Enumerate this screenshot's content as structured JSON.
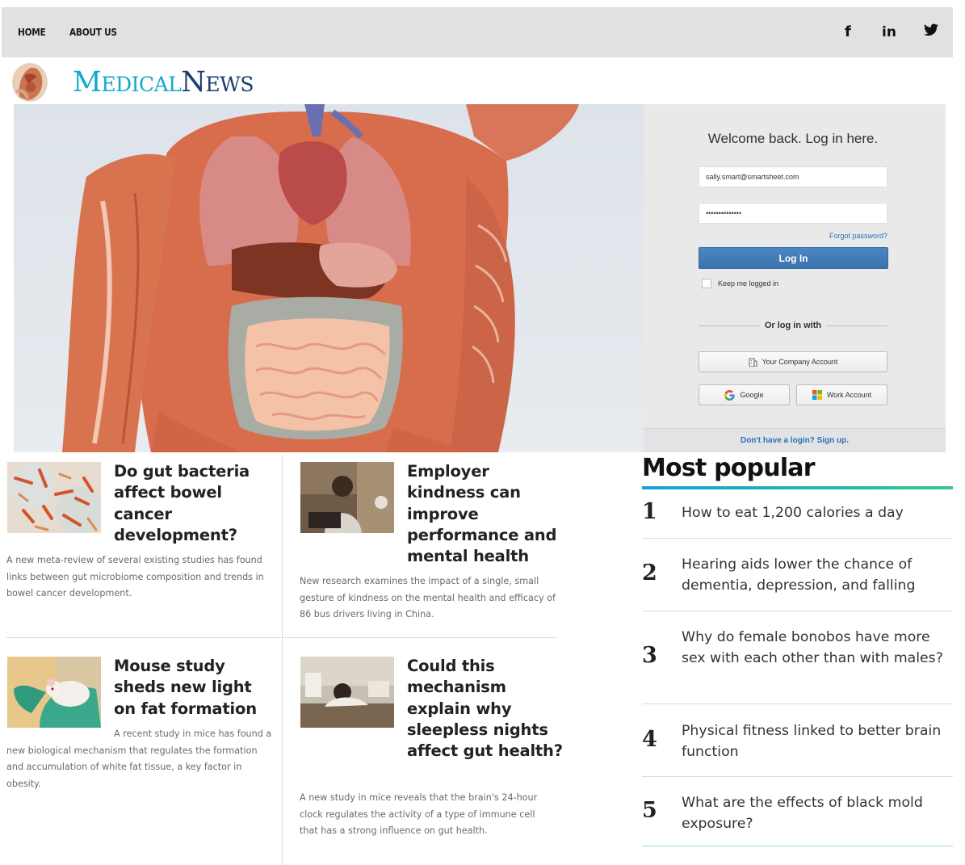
{
  "nav": {
    "links": [
      "HOME",
      "ABOUT US"
    ],
    "social": [
      {
        "icon": "facebook-icon",
        "glyph": "f"
      },
      {
        "icon": "linkedin-icon",
        "glyph": "in"
      },
      {
        "icon": "twitter-icon",
        "glyph": "🐦"
      }
    ]
  },
  "logo": {
    "part1_initial": "M",
    "part1_rest": "EDICAL",
    "part2_initial": "N",
    "part2_rest": "EWS"
  },
  "login": {
    "title": "Welcome back. Log in here.",
    "email_value": "sally.smart@smartsheet.com",
    "password_value": "••••••••••••••",
    "forgot": "Forgot password?",
    "button": "Log In",
    "keep_logged": "Keep me logged in",
    "or_text": "Or log in with",
    "company_account": "Your Company Account",
    "google": "Google",
    "work_account": "Work Account",
    "signup": "Don't have a login? Sign up."
  },
  "articles": [
    {
      "title": "Do gut bacteria affect bowel cancer development?",
      "description": "A new meta-review of several existing studies has found links between gut microbiome composition and trends in bowel cancer development."
    },
    {
      "title": "Employer kindness can improve performance and mental health",
      "description": "New research examines the impact of a single, small gesture of kindness on the mental health and efficacy of 86 bus drivers living in China."
    },
    {
      "title": "Mouse study sheds new light on fat formation",
      "description": "A recent study in mice has found a new biological mechanism that regulates the formation and accumulation of white fat tissue, a key factor in obesity."
    },
    {
      "title": "Could this mechanism explain why sleepless nights affect gut health?",
      "description": "A new study in mice reveals that the brain's 24-hour clock regulates the activity of a type of immune cell that has a strong influence on gut health."
    }
  ],
  "most_popular": {
    "title": "Most popular",
    "items": [
      {
        "num": "1",
        "text": "How to eat 1,200 calories a day"
      },
      {
        "num": "2",
        "text": "Hearing aids lower the chance of dementia, depression, and falling"
      },
      {
        "num": "3",
        "text": "Why do female bonobos have more sex with each other than with males?"
      },
      {
        "num": "4",
        "text": "Physical fitness linked to better brain function"
      },
      {
        "num": "5",
        "text": "What are the effects of black mold exposure?"
      }
    ]
  },
  "colors": {
    "brand_light": "#11a9cc",
    "brand_dark": "#1c3d6e",
    "login_button": "#3a73ad",
    "link": "#2f6fb7"
  }
}
